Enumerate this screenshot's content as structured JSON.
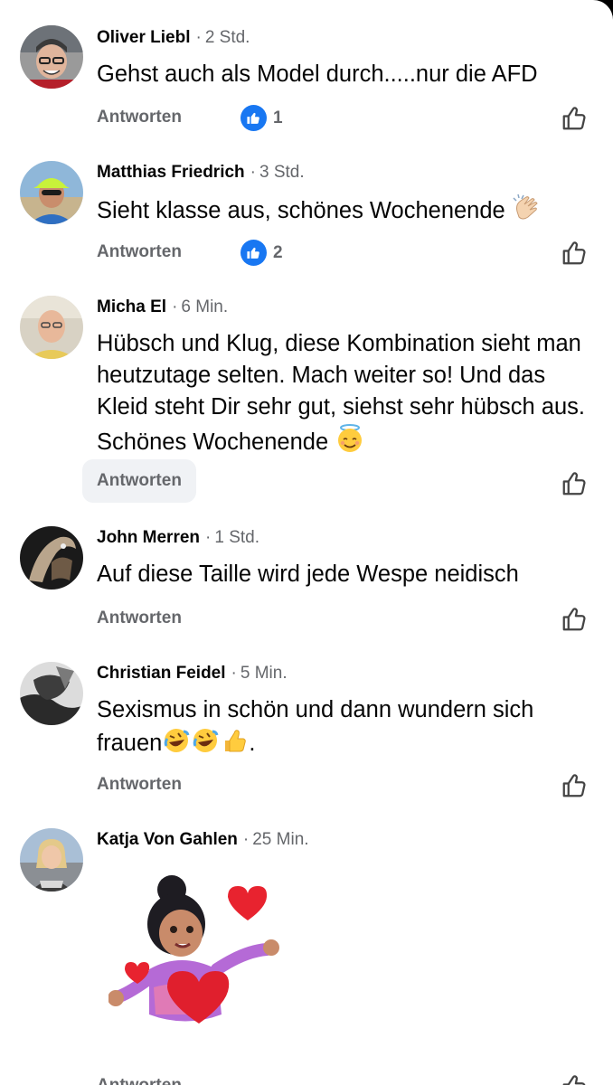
{
  "comments": [
    {
      "author": "Oliver Liebl",
      "time": "2 Std.",
      "text": "Gehst auch als Model durch.....nur  die AFD",
      "reply": "Antworten",
      "reactions": "1"
    },
    {
      "author": "Matthias Friedrich",
      "time": "3 Std.",
      "text": "Sieht klasse aus, schönes Wochenende",
      "reply": "Antworten",
      "reactions": "2"
    },
    {
      "author": "Micha El",
      "time": "6 Min.",
      "text": "Hübsch und Klug, diese Kombination sieht man heutzutage selten. Mach weiter so! Und das Kleid steht Dir sehr gut, siehst sehr hübsch aus. Schönes Wochenende",
      "reply": "Antworten"
    },
    {
      "author": "John Merren",
      "time": "1 Std.",
      "text": "Auf diese Taille wird jede Wespe neidisch",
      "reply": "Antworten"
    },
    {
      "author": "Christian Feidel",
      "time": "5 Min.",
      "text": "Sexismus in schön und dann wundern sich frauen",
      "text_end": ".",
      "reply": "Antworten"
    },
    {
      "author": "Katja Von Gahlen",
      "time": "25 Min.",
      "reply": "Antworten"
    }
  ],
  "separator": "·",
  "colors": {
    "like_blue": "#1877f2",
    "secondary_text": "#65676b",
    "primary_text": "#050505"
  },
  "icons": {
    "reaction": "like-reaction-icon",
    "like": "thumbs-up-outline-icon",
    "sticker": "hug-hearts-sticker"
  }
}
